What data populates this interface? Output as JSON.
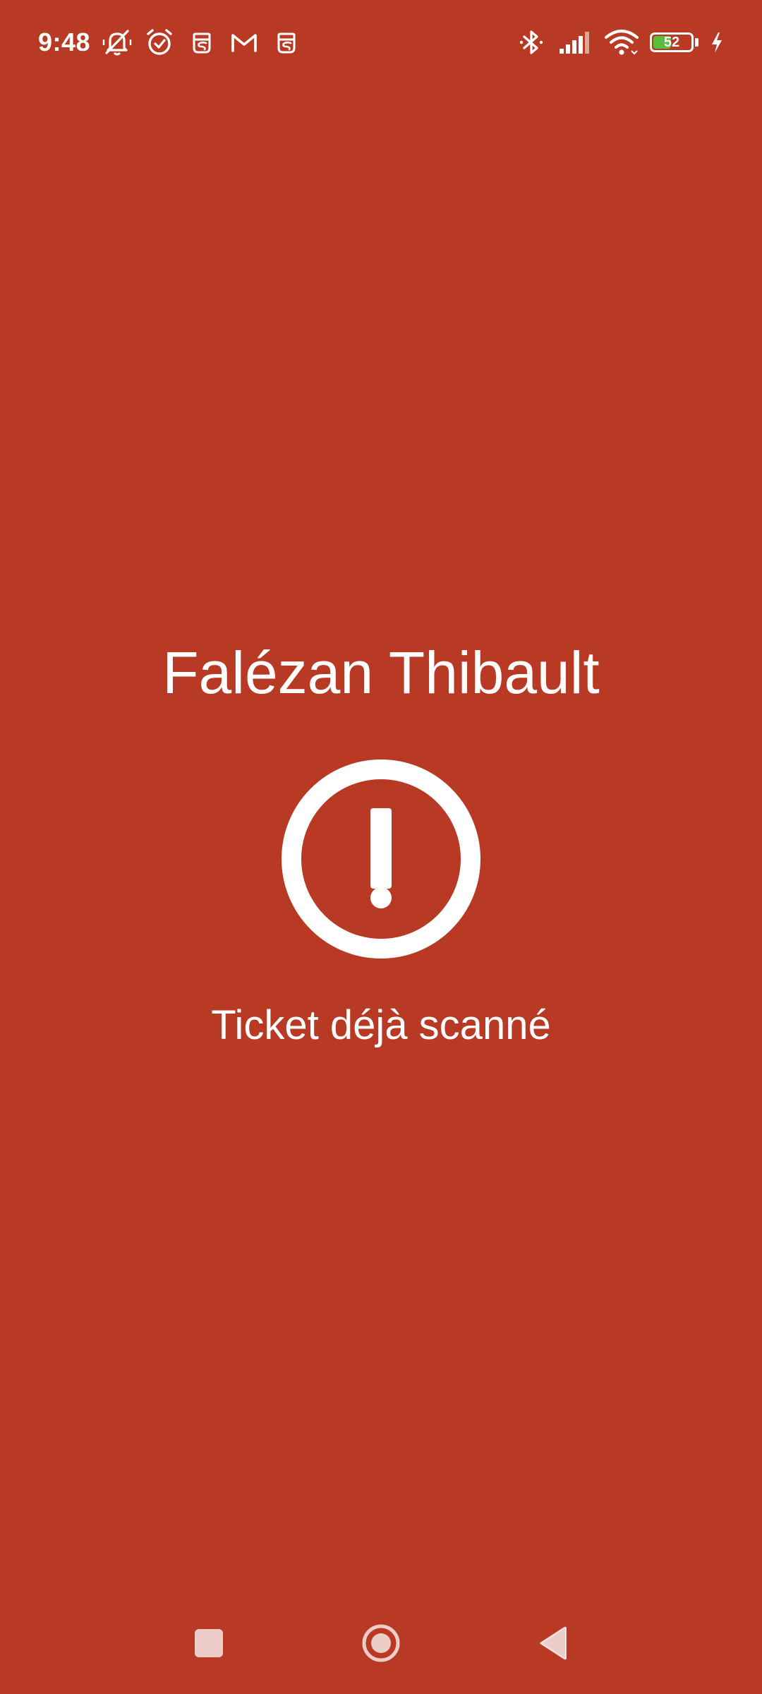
{
  "status_bar": {
    "time": "9:48",
    "left_icons": [
      "silent-bell-icon",
      "alarm-icon",
      "notification-app-icon",
      "gmail-icon",
      "notification-app-icon"
    ],
    "right_icons": [
      "bluetooth-icon",
      "signal-icon",
      "wifi-icon",
      "battery-icon",
      "charging-icon"
    ],
    "battery_level": "52"
  },
  "main": {
    "name": "Falézan Thibault",
    "status_icon": "exclamation-circle-icon",
    "message": "Ticket déjà scanné"
  },
  "nav_bar": {
    "items": [
      "recents-square-icon",
      "home-circle-icon",
      "back-triangle-icon"
    ]
  },
  "colors": {
    "background": "#B93A24",
    "foreground": "#FFFFFF",
    "battery_fill": "#5BBE3A"
  }
}
